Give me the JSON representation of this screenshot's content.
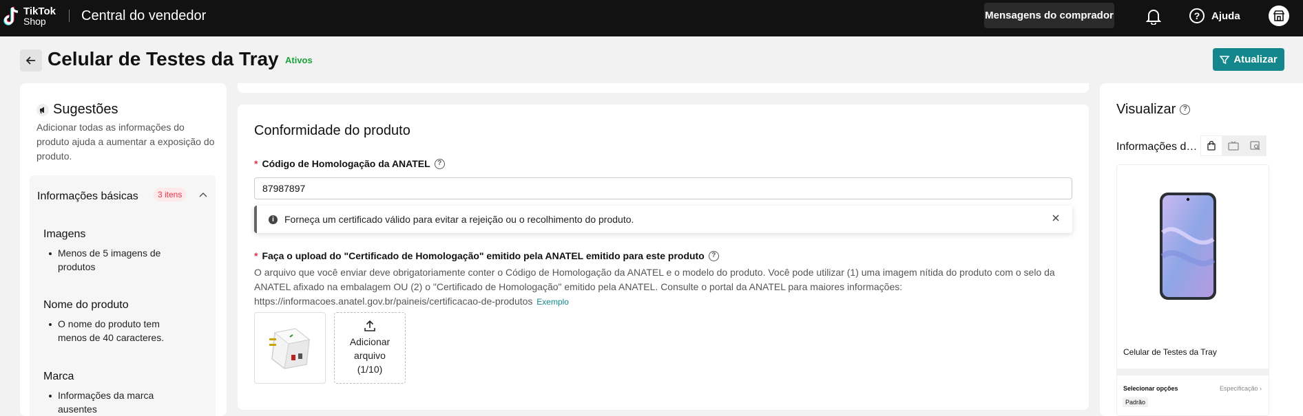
{
  "topbar": {
    "logo_line1": "TikTok",
    "logo_line2": "Shop",
    "title": "Central do vendedor",
    "messages_label": "Mensagens do comprador",
    "help_label": "Ajuda"
  },
  "header": {
    "title": "Celular de Testes da Tray",
    "status": "Ativos",
    "update_label": "Atualizar"
  },
  "suggestions": {
    "title": "Sugestões",
    "description": "Adicionar todas as informações do produto ajuda a aumentar a exposição do produto.",
    "basic": {
      "title": "Informações básicas",
      "badge": "3 itens",
      "groups": [
        {
          "title": "Imagens",
          "item": "Menos de 5 imagens de produtos"
        },
        {
          "title": "Nome do produto",
          "item": "O nome do produto tem menos de 40 caracteres."
        },
        {
          "title": "Marca",
          "item": "Informações da marca ausentes"
        }
      ]
    }
  },
  "compliance": {
    "title": "Conformidade do produto",
    "anatel_label": "Código de Homologação da ANATEL",
    "anatel_value": "87987897",
    "warning": "Forneça um certificado válido para evitar a rejeição ou o recolhimento do produto.",
    "upload_label": "Faça o upload do \"Certificado de Homologação\" emitido pela ANATEL emitido para este produto",
    "upload_desc": "O arquivo que você enviar deve obrigatoriamente conter o Código de Homologação da ANATEL e o modelo do produto. Você pode utilizar (1) uma imagem nítida do produto com o selo da ANATEL afixado na embalagem OU (2) o \"Certificado de Homologação\" emitido pela ANATEL. Consulte o portal da ANATEL para maiores informações: https://informacoes.anatel.gov.br/paineis/certificacao-de-produtos",
    "example_link": "Exemplo",
    "add_file_line1": "Adicionar",
    "add_file_line2": "arquivo",
    "add_file_count": "(1/10)"
  },
  "preview": {
    "title": "Visualizar",
    "subtitle": "Informações do produto",
    "product_name": "Celular de Testes da Tray",
    "options_label": "Selecionar opções",
    "options_right": "Especificação",
    "option_chip": "Padrão"
  },
  "colors": {
    "accent": "#13878b",
    "topbar": "#121212",
    "required": "#e0364a",
    "status_green": "#1aa33a"
  }
}
